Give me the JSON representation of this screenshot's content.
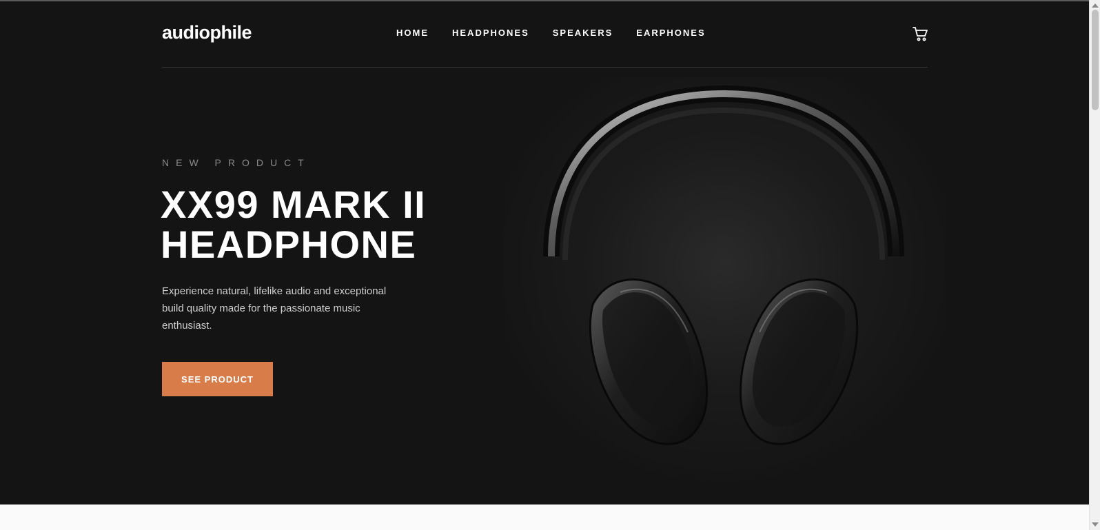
{
  "brand": {
    "name": "audiophile"
  },
  "nav": [
    {
      "label": "HOME"
    },
    {
      "label": "HEADPHONES"
    },
    {
      "label": "SPEAKERS"
    },
    {
      "label": "EARPHONES"
    }
  ],
  "hero": {
    "overline": "NEW PRODUCT",
    "title": "XX99 MARK II HEADPHONE",
    "description": "Experience natural, lifelike audio and exceptional build quality made for the passionate music enthusiast.",
    "cta_label": "SEE PRODUCT"
  },
  "icons": {
    "cart": "cart-icon"
  },
  "colors": {
    "hero_background": "#141414",
    "accent": "#d87d4a",
    "text_primary": "#ffffff",
    "text_muted": "#8a8a8a"
  }
}
